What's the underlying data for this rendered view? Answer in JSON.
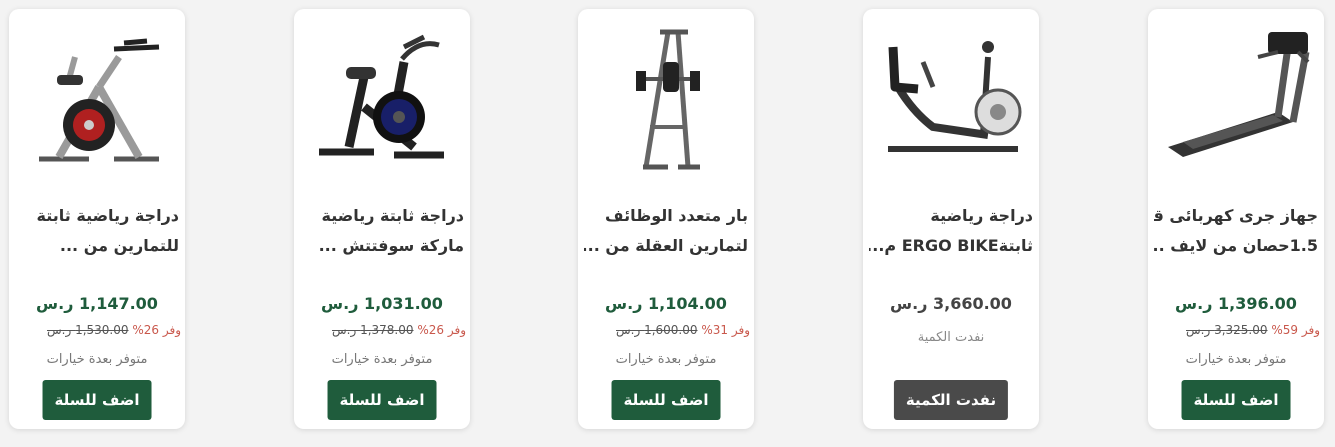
{
  "products": [
    {
      "title_line1": "دراجة رياضية ثابتة",
      "title_line2": "للتمارين من ...",
      "price": "1,147.00 ر.س",
      "old_price": "1,530.00 ر.س",
      "save": "وفر 26%",
      "availability": "متوفر بعدة خيارات",
      "button": "اضف للسلة",
      "image_icon": "spin-bike-image"
    },
    {
      "title_line1": "دراجة ثابتة رياضية",
      "title_line2": "ماركة سوفتتش ...",
      "price": "1,031.00 ر.س",
      "old_price": "1,378.00 ر.س",
      "save": "وفر 26%",
      "availability": "متوفر بعدة خيارات",
      "button": "اضف للسلة",
      "image_icon": "spin-bike-image"
    },
    {
      "title_line1": "بار متعدد الوظائف",
      "title_line2": "لتمارين العقلة من ...",
      "price": "1,104.00 ر.س",
      "old_price": "1,600.00 ر.س",
      "save": "وفر 31%",
      "availability": "متوفر بعدة خيارات",
      "button": "اضف للسلة",
      "image_icon": "power-tower-image"
    },
    {
      "title_line1": "دراجة رياضية",
      "title_line2": "ثابتةERGO BIKE م...",
      "price": "3,660.00 ر.س",
      "availability": "نفدت الكمية",
      "button": "نفدت الكمية",
      "image_icon": "recumbent-bike-image"
    },
    {
      "title_line1": "جهاز جرى كهربائى قوة",
      "title_line2": "1.5حصان من لايف ..",
      "price": "1,396.00 ر.س",
      "old_price": "3,325.00 ر.س",
      "save": "وفر 59%",
      "availability": "متوفر بعدة خيارات",
      "button": "اضف للسلة",
      "image_icon": "treadmill-image"
    }
  ],
  "colors": {
    "brand_green": "#1f5c3c",
    "discount_red": "#c9584c",
    "disabled": "#4a4a4a"
  }
}
